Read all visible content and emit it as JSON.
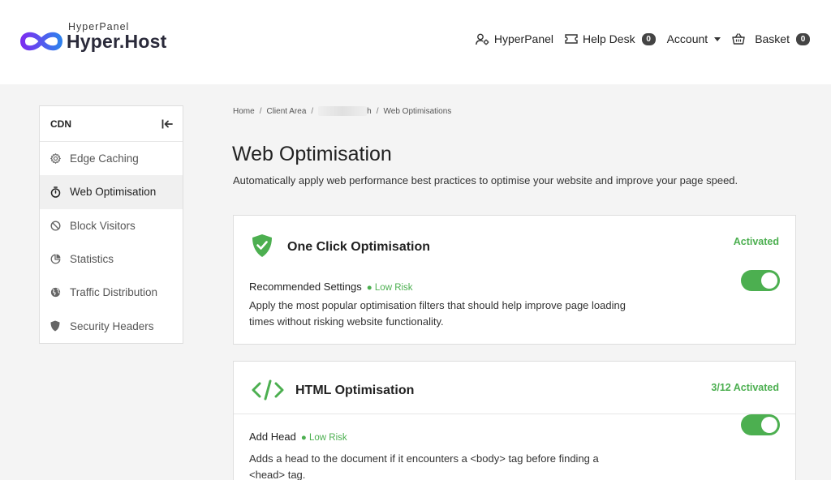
{
  "header": {
    "logo_sub": "HyperPanel",
    "logo_main": "Hyper.Host",
    "nav": {
      "hyperpanel": "HyperPanel",
      "helpdesk": "Help Desk",
      "helpdesk_count": "0",
      "account": "Account",
      "basket": "Basket",
      "basket_count": "0"
    }
  },
  "sidebar": {
    "title": "CDN",
    "items": [
      {
        "label": "Edge Caching",
        "icon": "gear-icon"
      },
      {
        "label": "Web Optimisation",
        "icon": "stopwatch-icon"
      },
      {
        "label": "Block Visitors",
        "icon": "ban-icon"
      },
      {
        "label": "Statistics",
        "icon": "pie-chart-icon"
      },
      {
        "label": "Traffic Distribution",
        "icon": "globe-icon"
      },
      {
        "label": "Security Headers",
        "icon": "shield-icon"
      }
    ]
  },
  "breadcrumb": {
    "home": "Home",
    "client_area": "Client Area",
    "domain_suffix": "h",
    "current": "Web Optimisations"
  },
  "page": {
    "title": "Web Optimisation",
    "description": "Automatically apply web performance best practices to optimise your website and improve your page speed."
  },
  "cards": [
    {
      "title": "One Click Optimisation",
      "status": "Activated",
      "setting_name": "Recommended Settings",
      "risk": "Low Risk",
      "description": "Apply the most popular optimisation filters that should help improve page loading times without risking website functionality."
    },
    {
      "title": "HTML Optimisation",
      "status": "3/12 Activated",
      "setting_name": "Add Head",
      "risk": "Low Risk",
      "description": "Adds a head to the document if it encounters a <body> tag before finding a <head> tag."
    }
  ],
  "colors": {
    "accent": "#4caf50",
    "badge": "#444444",
    "logo_purple": "#6a3de8",
    "logo_blue": "#3b6fe0"
  }
}
